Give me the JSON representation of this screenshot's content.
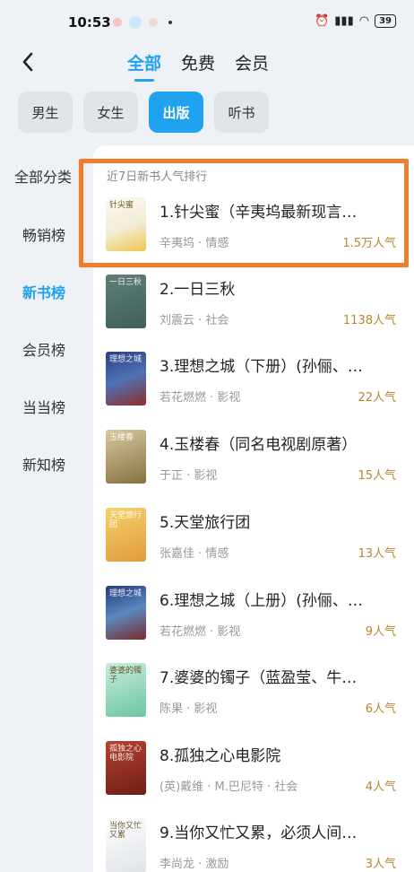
{
  "status_bar": {
    "time": "10:53",
    "battery": "39"
  },
  "nav": {
    "tabs": [
      {
        "label": "全部"
      },
      {
        "label": "免费"
      },
      {
        "label": "会员"
      }
    ]
  },
  "sub_tabs": [
    {
      "label": "男生"
    },
    {
      "label": "女生"
    },
    {
      "label": "出版"
    },
    {
      "label": "听书"
    }
  ],
  "sidebar": {
    "items": [
      {
        "label": "全部分类"
      },
      {
        "label": "畅销榜"
      },
      {
        "label": "新书榜"
      },
      {
        "label": "会员榜"
      },
      {
        "label": "当当榜"
      },
      {
        "label": "新知榜"
      }
    ]
  },
  "list": {
    "title": "近7日新书人气排行",
    "books": [
      {
        "title": "1.针尖蜜（辛夷坞最新现言…",
        "meta": "辛夷坞 · 情感",
        "popularity": "1.5万人气",
        "cover_text": "针尖蜜"
      },
      {
        "title": "2.一日三秋",
        "meta": "刘震云 · 社会",
        "popularity": "1138人气",
        "cover_text": "一日三秋"
      },
      {
        "title": "3.理想之城（下册）(孙俪、…",
        "meta": "若花燃燃 · 影视",
        "popularity": "22人气",
        "cover_text": "理想之城"
      },
      {
        "title": "4.玉楼春（同名电视剧原著）",
        "meta": "于正 · 影视",
        "popularity": "15人气",
        "cover_text": "玉楼春"
      },
      {
        "title": "5.天堂旅行团",
        "meta": "张嘉佳 · 情感",
        "popularity": "13人气",
        "cover_text": "天堂旅行团"
      },
      {
        "title": "6.理想之城（上册）(孙俪、…",
        "meta": "若花燃燃 · 影视",
        "popularity": "9人气",
        "cover_text": "理想之城"
      },
      {
        "title": "7.婆婆的镯子（蓝盈莹、牛…",
        "meta": "陈果 · 影视",
        "popularity": "6人气",
        "cover_text": "婆婆的镯子"
      },
      {
        "title": "8.孤独之心电影院",
        "meta": "(英)戴维 · M.巴尼特 · 社会",
        "popularity": "4人气",
        "cover_text": "孤独之心电影院"
      },
      {
        "title": "9.当你又忙又累，必须人间…",
        "meta": "李尚龙 · 激励",
        "popularity": "3人气",
        "cover_text": "当你又忙又累"
      }
    ]
  },
  "colors": {
    "accent": "#1fa2f0",
    "highlight": "#f47b2a",
    "popularity": "#b8872d"
  }
}
